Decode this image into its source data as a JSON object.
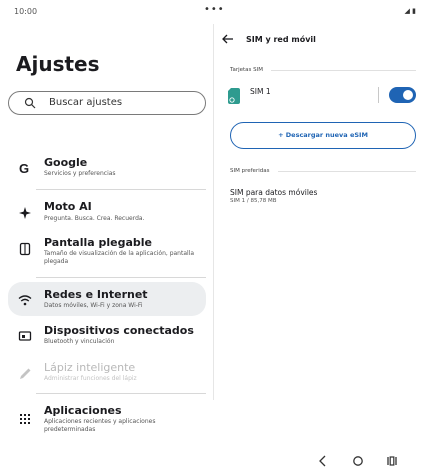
{
  "status_bar": {
    "time": "10:00",
    "center_indicator": "•••",
    "right_icons": "◢ ▮"
  },
  "settings": {
    "title": "Ajustes",
    "search_placeholder": "Buscar ajustes",
    "items": [
      {
        "icon": "google-icon",
        "title": "Google",
        "subtitle": "Servicios y preferencias"
      },
      {
        "icon": "sparkle-icon",
        "title": "Moto AI",
        "subtitle": "Pregunta. Busca. Crea. Recuerda."
      },
      {
        "icon": "foldable-phone-icon",
        "title": "Pantalla plegable",
        "subtitle": "Tamaño de visualización de la aplicación, pantalla plegada"
      },
      {
        "icon": "wifi-icon",
        "title": "Redes e Internet",
        "subtitle": "Datos móviles, Wi-Fi y zona Wi-Fi"
      },
      {
        "icon": "connected-devices-icon",
        "title": "Dispositivos conectados",
        "subtitle": "Bluetooth y vinculación"
      },
      {
        "icon": "pen-icon",
        "title": "Lápiz inteligente",
        "subtitle": "Administrar funciones del lápiz"
      },
      {
        "icon": "apps-grid-icon",
        "title": "Aplicaciones",
        "subtitle": "Aplicaciones recientes y aplicaciones predeterminadas"
      }
    ],
    "selected_item": "Redes e Internet",
    "disabled_item": "Lápiz inteligente"
  },
  "detail": {
    "title": "SIM y red móvil",
    "sim_section_label": "Tarjetas SIM",
    "sim_name": "SIM 1",
    "sim_enabled": true,
    "download_esim_label": "+ Descargar nueva eSIM",
    "preferred_section_label": "SIM preferidas",
    "preferred_data_title": "SIM para datos móviles",
    "preferred_data_value": "SIM 1 / 85,78 MB"
  },
  "colors": {
    "accent": "#1f64b4",
    "selected_background": "#eceef0",
    "sim_icon": "#2e9b8f"
  }
}
